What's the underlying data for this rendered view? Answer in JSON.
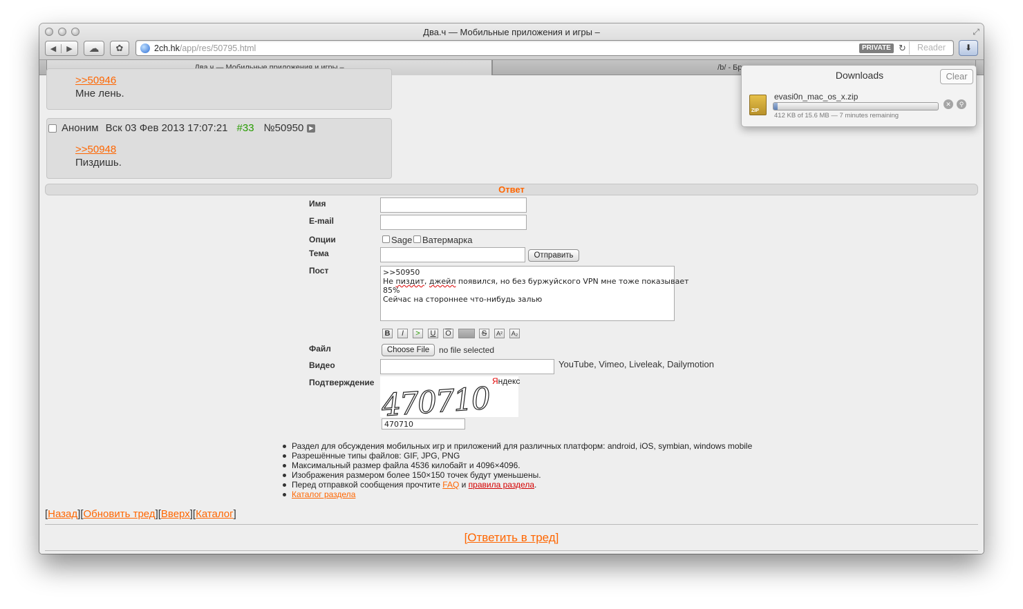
{
  "window": {
    "title": "Два.ч — Мобильные приложения и игры –"
  },
  "toolbar": {
    "back_icon": "◀",
    "forward_icon": "▶",
    "icloud_icon": "☁",
    "paw_icon": "✿",
    "url_host": "2ch.hk",
    "url_path": "/app/res/50795.html",
    "private_badge": "PRIVATE",
    "reload_icon": "↻",
    "reader_label": "Reader",
    "downloads_icon": "⬇"
  },
  "tabs": [
    {
      "label": "Два.ч — Мобильные приложения и игры –"
    },
    {
      "label": "/b/ - Бред"
    }
  ],
  "posts": [
    {
      "link": ">>50946",
      "text": "Мне лень."
    },
    {
      "author": "Аноним",
      "date": "Вск 03 Фев 2013 17:07:21",
      "num": "#33",
      "id": "№50950",
      "link": ">>50948",
      "text": "Пиздишь."
    }
  ],
  "reply_form": {
    "heading": "Ответ",
    "name_label": "Имя",
    "email_label": "E-mail",
    "options_label": "Опции",
    "sage_label": "Sage",
    "watermark_label": "Ватермарка",
    "subject_label": "Тема",
    "submit_label": "Отправить",
    "post_label": "Пост",
    "post_lines": [
      "Не ",
      "пиздит",
      ", ",
      "джейл",
      " появился, но без буржуйского VPN мне тоже показывает"
    ],
    "post_line1": ">>50950",
    "post_line3": "85%",
    "post_line4": "Сейчас на стороннее что-нибудь залью",
    "format_buttons": [
      "B",
      "I",
      ">",
      "U",
      "O",
      "",
      "S",
      "A²",
      "A₂"
    ],
    "file_label": "Файл",
    "choose_file_label": "Choose File",
    "no_file_text": "no file selected",
    "video_label": "Видео",
    "video_hint": "YouTube, Vimeo, Liveleak, Dailymotion",
    "captcha_label": "Подтверждение",
    "captcha_digits": "470710",
    "captcha_brand_first": "Я",
    "captcha_brand_rest": "ндекс",
    "captcha_value": "470710"
  },
  "rules": {
    "r1": "Раздел для обсуждения мобильных игр и приложений для различных платформ: android, iOS, symbian, windows mobile",
    "r2": "Разрешённые типы файлов: GIF, JPG, PNG",
    "r3": "Максимальный размер файла 4536 килобайт и 4096×4096.",
    "r4": "Изображения размером более 150×150 точек будут уменьшены.",
    "r5_before": "Перед отправкой сообщения прочтите ",
    "r5_faq": "FAQ",
    "r5_and": " и ",
    "r5_rules": "правила раздела",
    "r5_end": ".",
    "r6": "Каталог раздела"
  },
  "nav": {
    "back": "Назад",
    "refresh": "Обновить тред",
    "top": "Вверх",
    "catalog": "Каталог",
    "reply_thread": "[Ответить в тред]"
  },
  "downloads": {
    "title": "Downloads",
    "clear_label": "Clear",
    "zip_badge": "ZIP",
    "file_name": "evasi0n_mac_os_x.zip",
    "progress_fraction": 0.026,
    "status": "412 KB of 15.6 MB — 7 minutes remaining",
    "stop_icon": "✕",
    "reveal_icon": "⚲"
  }
}
